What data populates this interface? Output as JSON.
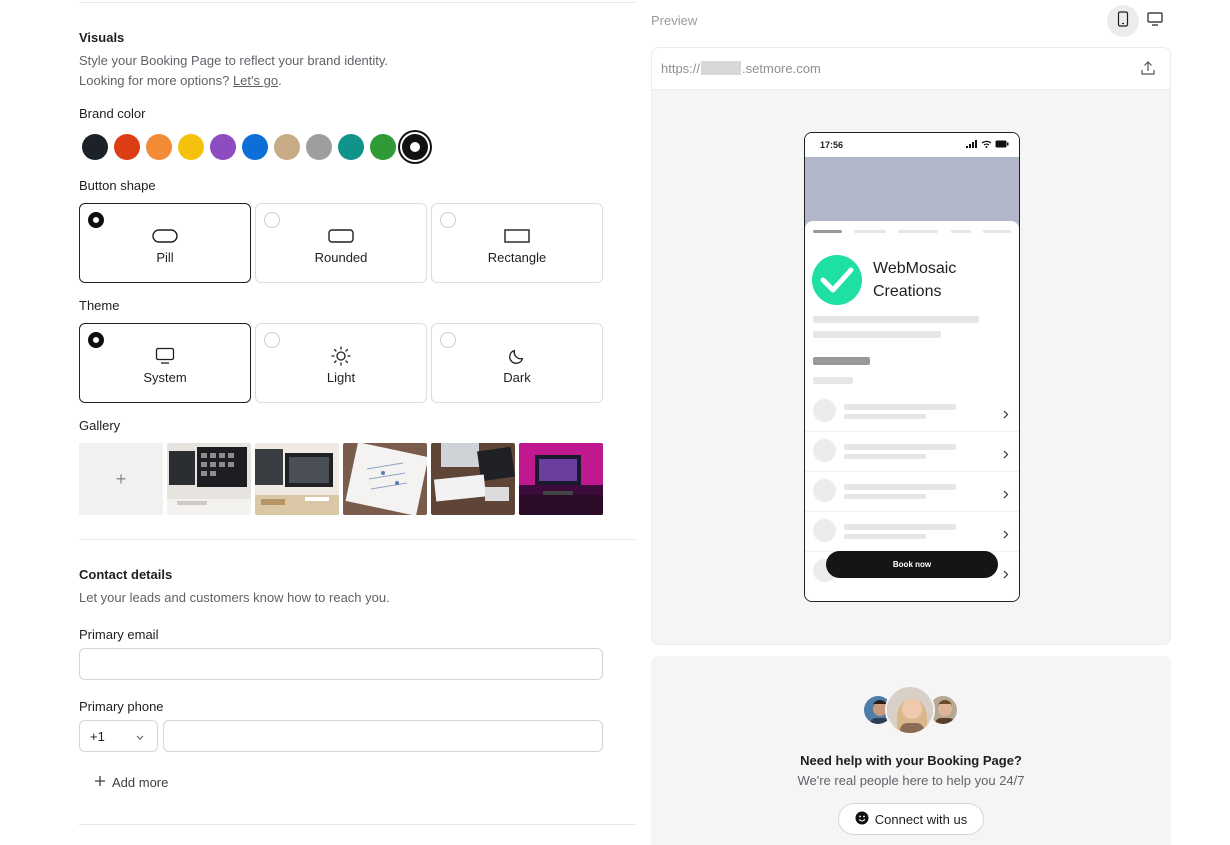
{
  "visuals": {
    "title": "Visuals",
    "desc1": "Style your Booking Page to reflect your brand identity.",
    "desc2_prefix": "Looking for more options? ",
    "desc2_link": "Let's go",
    "desc2_suffix": "."
  },
  "brand_color": {
    "label": "Brand color",
    "swatches": [
      "#1d2228",
      "#dc3d14",
      "#f28a36",
      "#f6c10d",
      "#8e4cc1",
      "#0c6ed6",
      "#c6ab84",
      "#9e9e9e",
      "#109489",
      "#2f9a36",
      "#111111"
    ],
    "selected_index": 10
  },
  "button_shape": {
    "label": "Button shape",
    "options": [
      "Pill",
      "Rounded",
      "Rectangle"
    ],
    "selected": "Pill"
  },
  "theme": {
    "label": "Theme",
    "options": [
      "System",
      "Light",
      "Dark"
    ],
    "selected": "System"
  },
  "gallery": {
    "label": "Gallery",
    "add_symbol": "+"
  },
  "contact": {
    "title": "Contact details",
    "desc": "Let your leads and customers know how to reach you.",
    "email_label": "Primary email",
    "email_value": "",
    "phone_label": "Primary phone",
    "country_code": "+1",
    "phone_value": "",
    "add_more": "Add more"
  },
  "preview": {
    "label": "Preview",
    "url_prefix": "https://",
    "url_suffix": ".setmore.com",
    "status_time": "17:56",
    "business_name": "WebMosaic Creations",
    "book_now": "Book now",
    "brand_logo_color": "#1fe0a4",
    "banner_color": "#b1b7c8"
  },
  "help": {
    "title": "Need help with your Booking Page?",
    "subtitle": "We're real people here to help you 24/7",
    "button": "Connect with us"
  }
}
